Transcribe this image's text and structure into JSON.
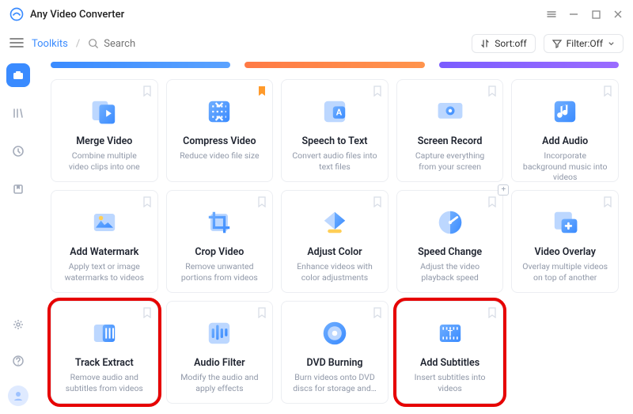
{
  "app": {
    "title": "Any Video Converter"
  },
  "toolbar": {
    "breadcrumb": "Toolkits",
    "search_placeholder": "Search",
    "sort_label": "Sort:off",
    "filter_label": "Filter:Off"
  },
  "bars": [
    {
      "color": "linear-gradient(90deg,#3a8bff,#5aa2ff)"
    },
    {
      "color": "linear-gradient(90deg,#ff7a45,#ff944d)"
    },
    {
      "color": "linear-gradient(90deg,#7a5cff,#9a6bff)"
    }
  ],
  "cards": [
    {
      "title": "Merge Video",
      "desc": "Combine multiple video clips into one",
      "icon": "merge",
      "bookmarked": false,
      "highlight": false
    },
    {
      "title": "Compress Video",
      "desc": "Reduce video file size",
      "icon": "compress",
      "bookmarked": true,
      "highlight": false
    },
    {
      "title": "Speech to Text",
      "desc": "Convert audio files into text files",
      "icon": "speechtext",
      "bookmarked": false,
      "highlight": false
    },
    {
      "title": "Screen Record",
      "desc": "Capture everything from your screen",
      "icon": "screenrec",
      "bookmarked": false,
      "highlight": false
    },
    {
      "title": "Add Audio",
      "desc": "Incorporate background music into videos",
      "icon": "addaudio",
      "bookmarked": false,
      "highlight": false
    },
    {
      "title": "Add Watermark",
      "desc": "Apply text or image watermarks to videos",
      "icon": "watermark",
      "bookmarked": false,
      "highlight": false
    },
    {
      "title": "Crop Video",
      "desc": "Remove unwanted portions from videos",
      "icon": "crop",
      "bookmarked": false,
      "highlight": false
    },
    {
      "title": "Adjust Color",
      "desc": "Enhance videos with color adjustments",
      "icon": "adjustcolor",
      "bookmarked": false,
      "highlight": false
    },
    {
      "title": "Speed Change",
      "desc": "Adjust the video playback speed",
      "icon": "speed",
      "bookmarked": false,
      "highlight": false,
      "plus": true
    },
    {
      "title": "Video Overlay",
      "desc": "Overlay multiple videos on top of another",
      "icon": "overlay",
      "bookmarked": false,
      "highlight": false
    },
    {
      "title": "Track Extract",
      "desc": "Remove audio and subtitles from videos",
      "icon": "trackextract",
      "bookmarked": false,
      "highlight": true
    },
    {
      "title": "Audio Filter",
      "desc": "Modify the audio and apply effects",
      "icon": "audiofilter",
      "bookmarked": false,
      "highlight": false
    },
    {
      "title": "DVD Burning",
      "desc": "Burn videos onto DVD discs for storage and…",
      "icon": "dvd",
      "bookmarked": false,
      "highlight": false
    },
    {
      "title": "Add Subtitles",
      "desc": "Insert subtitles into videos",
      "icon": "subtitles",
      "bookmarked": false,
      "highlight": true
    }
  ]
}
